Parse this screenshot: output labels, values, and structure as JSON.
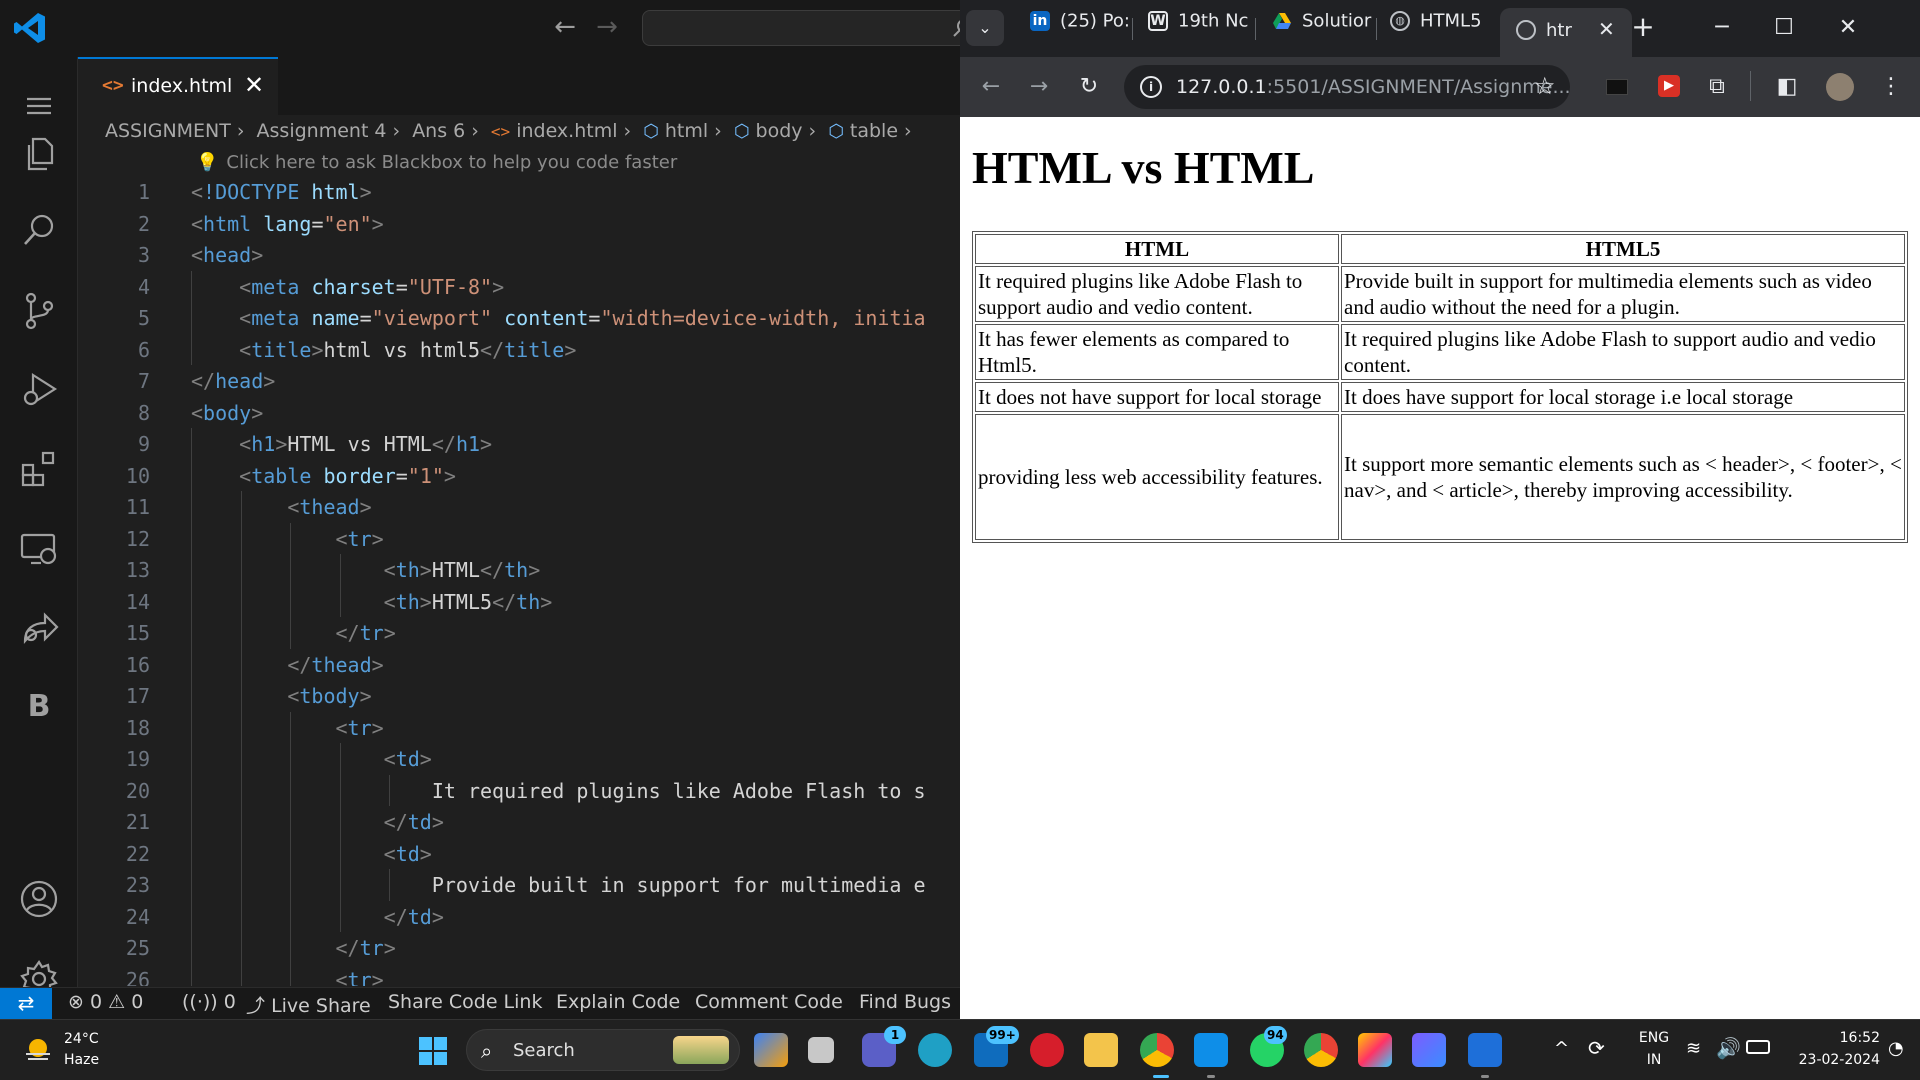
{
  "vscode": {
    "tab": {
      "label": "index.html"
    },
    "breadcrumb": [
      "ASSIGNMENT",
      "Assignment 4",
      "Ans 6",
      "index.html",
      "html",
      "body",
      "table"
    ],
    "blackbox_hint": "Click here to ask Blackbox to help you code faster",
    "line_numbers": [
      "1",
      "2",
      "3",
      "4",
      "5",
      "6",
      "7",
      "8",
      "9",
      "10",
      "11",
      "12",
      "13",
      "14",
      "15",
      "16",
      "17",
      "18",
      "19",
      "20",
      "21",
      "22",
      "23",
      "24",
      "25",
      "26"
    ],
    "code_lines": [
      "<!DOCTYPE html>",
      "<html lang=\"en\">",
      "<head>",
      "    <meta charset=\"UTF-8\">",
      "    <meta name=\"viewport\" content=\"width=device-width, initia",
      "    <title>html vs html5</title>",
      "</head>",
      "<body>",
      "    <h1>HTML vs HTML</h1>",
      "    <table border=\"1\">",
      "        <thead>",
      "            <tr>",
      "                <th>HTML</th>",
      "                <th>HTML5</th>",
      "            </tr>",
      "        </thead>",
      "        <tbody>",
      "            <tr>",
      "                <td>",
      "                    It required plugins like Adobe Flash to s",
      "                </td>",
      "                <td>",
      "                    Provide built in support for multimedia e",
      "                </td>",
      "            </tr>",
      "            <tr>"
    ],
    "status": {
      "errors": "0",
      "warnings": "0",
      "ports": "0",
      "live_share": "Live Share",
      "share_code_link": "Share Code Link",
      "explain_code": "Explain Code",
      "comment_code": "Comment Code",
      "find_bugs": "Find Bugs"
    }
  },
  "chrome": {
    "tabs": [
      {
        "label": "(25) Po:",
        "icon": "linkedin-icon"
      },
      {
        "label": "19th Nc",
        "icon": "wordpress-icon"
      },
      {
        "label": "Solutior",
        "icon": "google-drive-icon"
      },
      {
        "label": "HTML5",
        "icon": "globe-icon"
      }
    ],
    "active_tab": {
      "label": "htr"
    },
    "url_host": "127.0.0.1",
    "url_rest": ":5501/ASSIGNMENT/Assignme..."
  },
  "page": {
    "heading": "HTML vs HTML",
    "table": {
      "headers": [
        "HTML",
        "HTML5"
      ],
      "rows": [
        [
          "It required plugins like Adobe Flash to support audio and vedio content.",
          "Provide built in support for multimedia elements such as video and audio without the need for a plugin."
        ],
        [
          "It has fewer elements as compared to Html5.",
          "It required plugins like Adobe Flash to support audio and vedio content."
        ],
        [
          "It does not have support for local storage",
          "It does have support for local storage i.e local storage"
        ],
        [
          "providing less web accessibility features.",
          "It support more semantic elements such as < header>, < footer>, < nav>, and < article>, thereby improving accessibility."
        ]
      ]
    }
  },
  "taskbar": {
    "weather_temp": "24°C",
    "weather_cond": "Haze",
    "search_label": "Search",
    "badges": {
      "teams": "1",
      "mail": "99+",
      "whatsapp": "94"
    },
    "lang_1": "ENG",
    "lang_2": "IN",
    "time": "16:52",
    "date": "23-02-2024"
  },
  "colors": {
    "vscode_bg": "#1f1f1f",
    "accent": "#0078d4",
    "tag": "#569cd6",
    "attr": "#9cdcfe",
    "string": "#ce9178"
  }
}
